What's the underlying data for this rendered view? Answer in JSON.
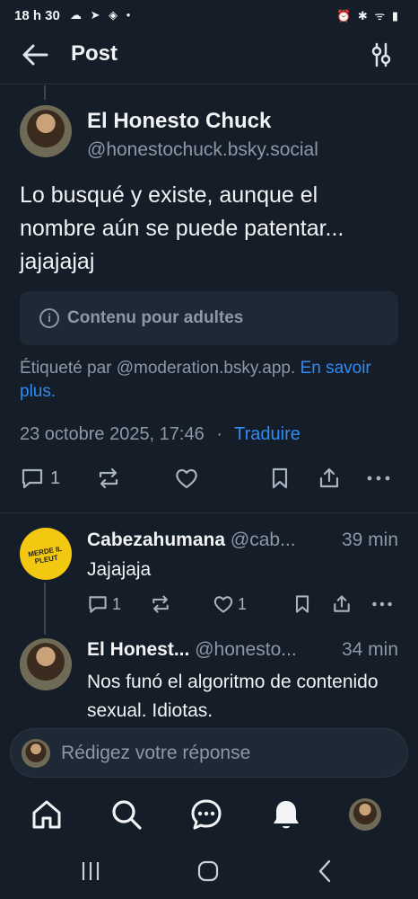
{
  "status_bar": {
    "time": "18 h 30",
    "left_icons": "☁ ➤ ◈ •",
    "right_icons": "⏰ ✱ ᯤ ▮"
  },
  "header": {
    "title": "Post"
  },
  "post": {
    "author_name": "El Honesto Chuck",
    "author_handle": "@honestochuck.bsky.social",
    "text": "Lo busqué y existe, aunque el nombre aún se puede patentar... jajajajaj",
    "content_warning": "Contenu pour adultes",
    "label_note": "Étiqueté par @moderation.bsky.app.",
    "label_link": "En savoir plus.",
    "date": "23 octobre 2025, 17:46",
    "date_sep": "·",
    "translate": "Traduire",
    "reply_count": "1"
  },
  "replies": [
    {
      "name": "Cabezahumana",
      "handle": "@cab...",
      "time": "39 min",
      "text": "Jajajaja",
      "avatar_text": "MERDE IL PLEUT",
      "reply_count": "1",
      "like_count": "1"
    },
    {
      "name": "El Honest...",
      "handle": "@honesto...",
      "time": "34 min",
      "text": "Nos funó el algoritmo de contenido sexual. Idiotas."
    }
  ],
  "composer": {
    "placeholder": "Rédigez votre réponse"
  },
  "colors": {
    "background": "#151d28",
    "accent": "#2f8bf4",
    "muted": "#8d98a6",
    "card": "#1f2935"
  }
}
